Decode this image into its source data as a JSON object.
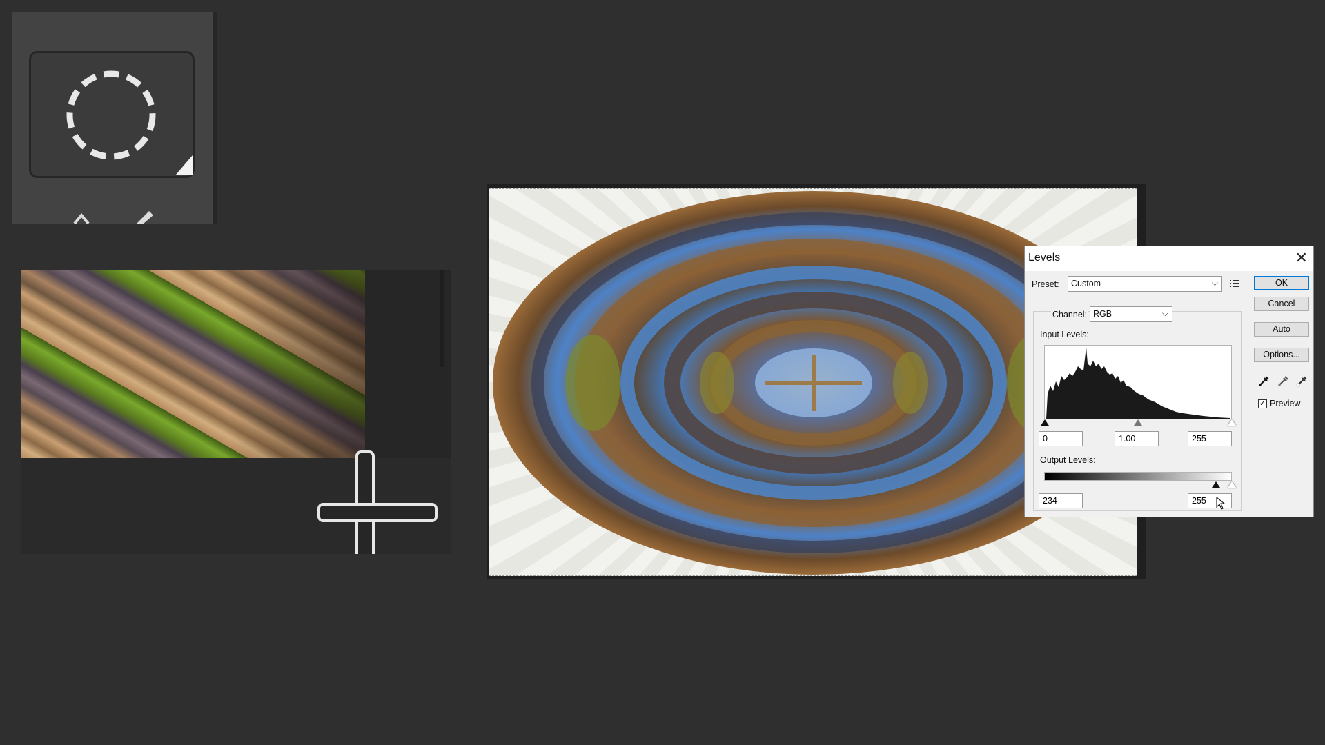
{
  "levels": {
    "title": "Levels",
    "preset_label": "Preset:",
    "preset_value": "Custom",
    "channel_label": "Channel:",
    "channel_value": "RGB",
    "input_levels_label": "Input Levels:",
    "input_black": "0",
    "input_gamma": "1.00",
    "input_white": "255",
    "output_levels_label": "Output Levels:",
    "output_black": "234",
    "output_white": "255",
    "buttons": {
      "ok": "OK",
      "cancel": "Cancel",
      "auto": "Auto",
      "options": "Options..."
    },
    "preview_label": "Preview",
    "preview_checked": true
  },
  "icons": {
    "tool": "elliptical-marquee-icon",
    "crosshair": "crosshair-cursor-icon",
    "preset_menu": "preset-options-icon",
    "eyedroppers": [
      "black-point-eyedropper-icon",
      "gray-point-eyedropper-icon",
      "white-point-eyedropper-icon"
    ],
    "close": "close-icon",
    "cursor": "mouse-pointer-icon"
  },
  "colors": {
    "workspace": "#2f2f2f",
    "dialog": "#f0f0f0",
    "accent": "#0078d7"
  }
}
